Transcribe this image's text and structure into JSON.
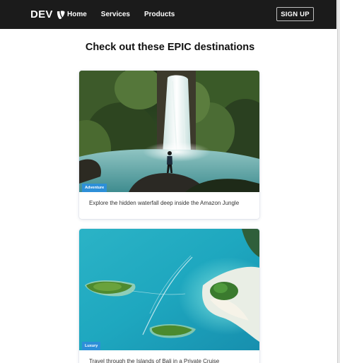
{
  "navbar": {
    "brand": "DEV",
    "links": [
      "Home",
      "Services",
      "Products"
    ],
    "signup_label": "SIGN UP",
    "background": "#1b1b1b"
  },
  "heading": "Check out these EPIC destinations",
  "cards": [
    {
      "tag": "Adventure",
      "title": "Explore the hidden waterfall deep inside the Amazon Jungle",
      "image": "waterfall-photo"
    },
    {
      "tag": "Luxury",
      "title": "Travel through the Islands of Bali in a Private Cruise",
      "image": "islands-aerial-photo"
    }
  ],
  "colors": {
    "badge": "#2d8fd8",
    "text": "#333333"
  }
}
